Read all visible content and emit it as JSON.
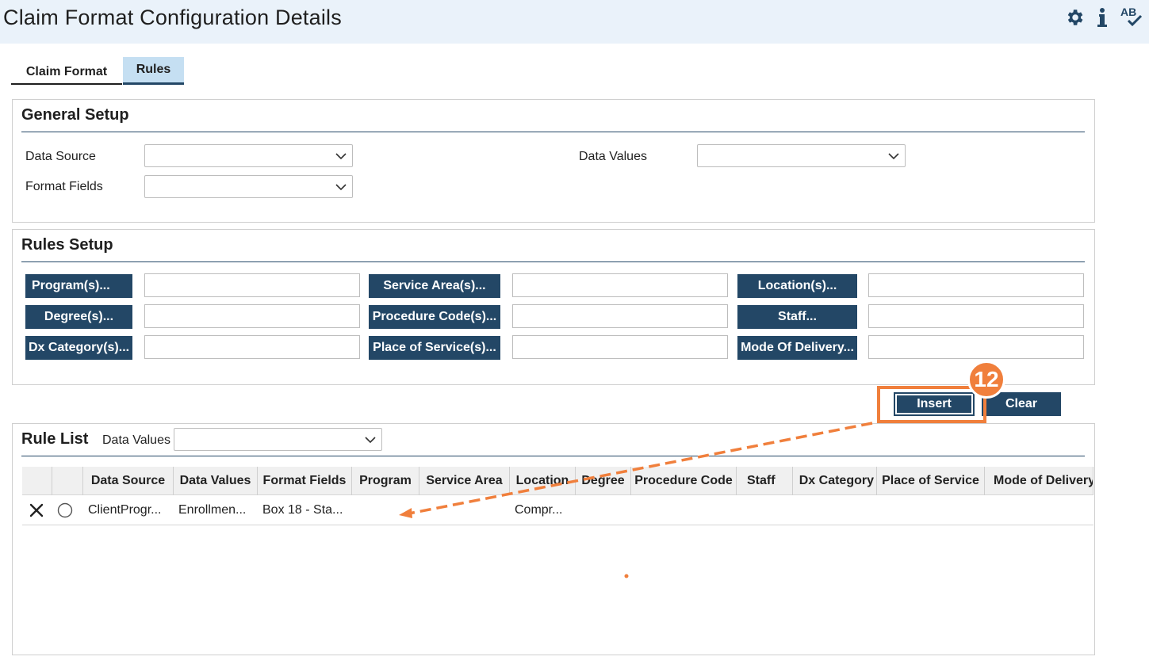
{
  "header": {
    "title": "Claim Format Configuration Details",
    "icons": [
      "gear-icon",
      "info-icon",
      "spellcheck-icon"
    ],
    "spellcheck_label": "AB"
  },
  "tabs": [
    {
      "label": "Claim Format",
      "active": false
    },
    {
      "label": "Rules",
      "active": true
    }
  ],
  "general_setup": {
    "title": "General Setup",
    "data_source_label": "Data Source",
    "format_fields_label": "Format Fields",
    "data_values_label": "Data Values"
  },
  "rules_setup": {
    "title": "Rules Setup",
    "buttons": [
      "Program(s)...",
      "Service Area(s)...",
      "Location(s)...",
      "Degree(s)...",
      "Procedure Code(s)...",
      "Staff...",
      "Dx Category(s)...",
      "Place of Service(s)...",
      "Mode Of Delivery..."
    ]
  },
  "actions": {
    "insert_label": "Insert",
    "clear_label": "Clear"
  },
  "rule_list": {
    "title": "Rule List",
    "data_values_label": "Data Values",
    "columns": [
      "Data Source",
      "Data Values",
      "Format Fields",
      "Program",
      "Service Area",
      "Location",
      "Degree",
      "Procedure Code",
      "Staff",
      "Dx Category",
      "Place of Service",
      "Mode of Delivery"
    ],
    "rows": [
      {
        "data_source": "ClientProgr...",
        "data_values": "Enrollmen...",
        "format_fields": "Box 18 - Sta...",
        "location": "Compr..."
      }
    ]
  },
  "callout": {
    "step": "12",
    "color": "#f07f3c"
  },
  "colors": {
    "header_bg": "#eaf2fa",
    "button_navy": "#234766",
    "tab_active": "#c5dff2",
    "accent_orange": "#f07f3c"
  }
}
